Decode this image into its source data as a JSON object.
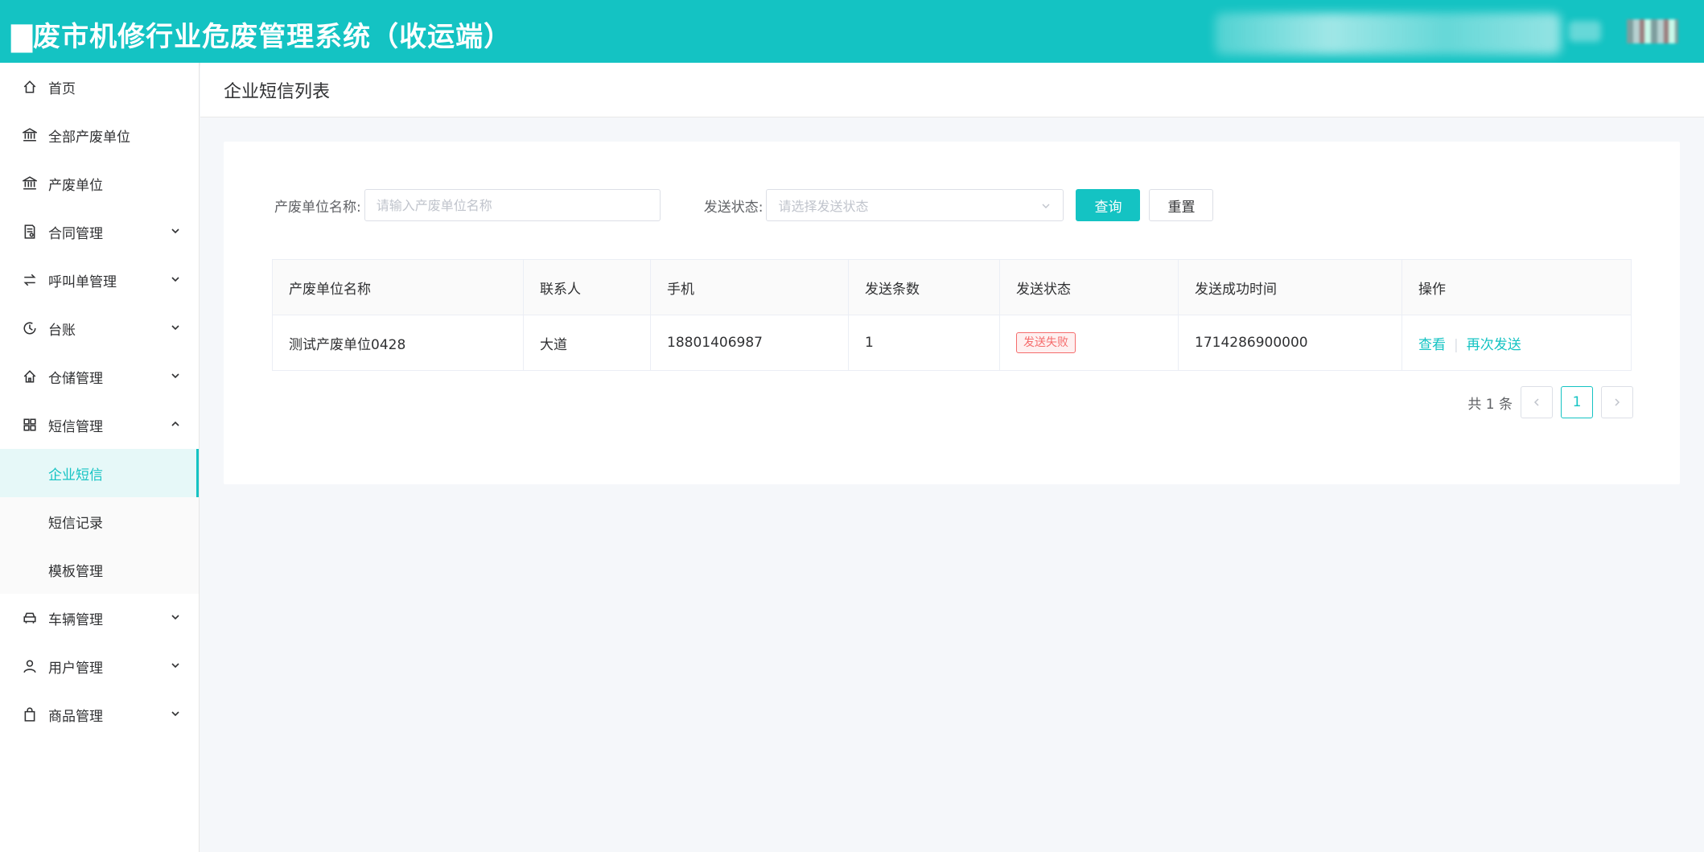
{
  "app": {
    "title": "▇废市机修行业危废管理系统（收运端）"
  },
  "sidebar": {
    "items": [
      {
        "label": "首页",
        "icon": "home-icon"
      },
      {
        "label": "全部产废单位",
        "icon": "bank-icon"
      },
      {
        "label": "产废单位",
        "icon": "bank-icon"
      },
      {
        "label": "合同管理",
        "icon": "contract-icon"
      },
      {
        "label": "呼叫单管理",
        "icon": "swap-icon"
      },
      {
        "label": "台账",
        "icon": "clock-icon"
      },
      {
        "label": "仓储管理",
        "icon": "warehouse-icon"
      },
      {
        "label": "短信管理",
        "icon": "grid-icon"
      }
    ],
    "sms_sub": [
      {
        "label": "企业短信"
      },
      {
        "label": "短信记录"
      },
      {
        "label": "模板管理"
      }
    ],
    "after": [
      {
        "label": "车辆管理",
        "icon": "car-icon"
      },
      {
        "label": "用户管理",
        "icon": "user-icon"
      },
      {
        "label": "商品管理",
        "icon": "bag-icon"
      }
    ]
  },
  "page": {
    "title": "企业短信列表"
  },
  "filters": {
    "name_label": "产废单位名称:",
    "name_placeholder": "请输入产废单位名称",
    "status_label": "发送状态:",
    "status_placeholder": "请选择发送状态",
    "query_label": "查询",
    "reset_label": "重置"
  },
  "table": {
    "columns": [
      "产废单位名称",
      "联系人",
      "手机",
      "发送条数",
      "发送状态",
      "发送成功时间",
      "操作"
    ],
    "rows": [
      {
        "name": "测试产废单位0428",
        "contact": "大道",
        "phone": "18801406987",
        "count": "1",
        "status": "发送失败",
        "time": "1714286900000",
        "action_view": "查看",
        "action_resend": "再次发送"
      }
    ]
  },
  "pagination": {
    "total_text": "共 1 条",
    "current_page": "1"
  },
  "colors": {
    "accent": "#14c3c3",
    "danger": "#f56c6c"
  }
}
